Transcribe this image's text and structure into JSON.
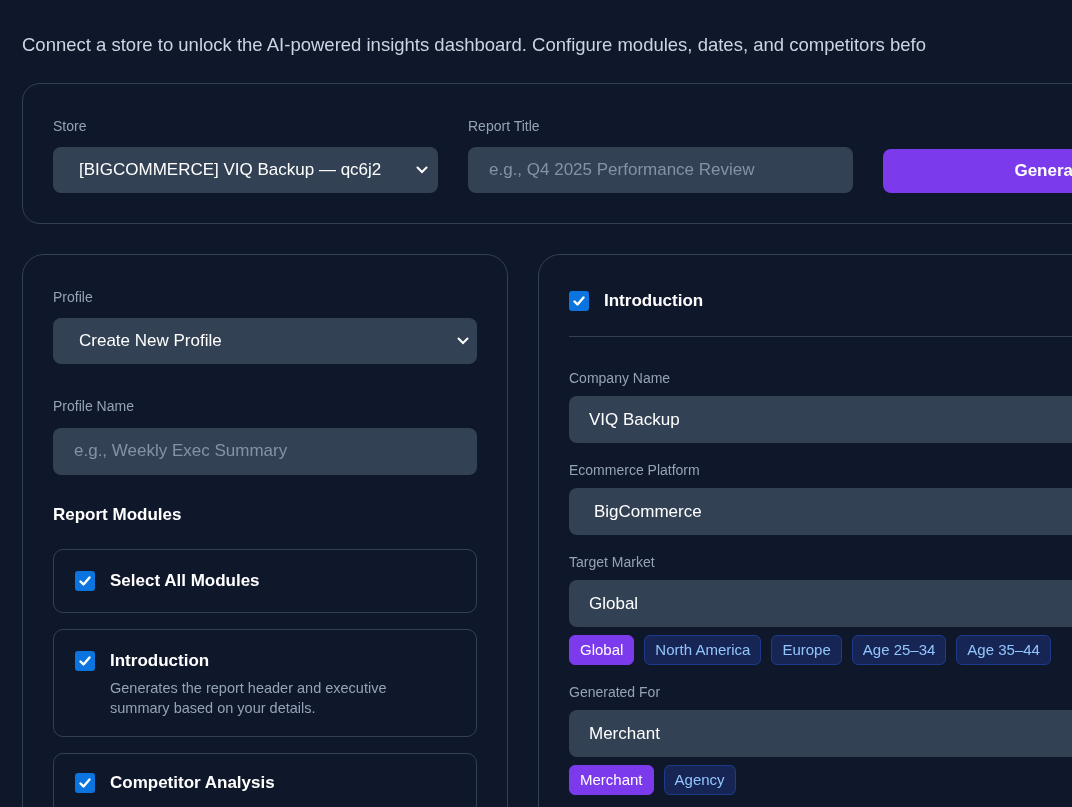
{
  "intro": "Connect a store to unlock the AI-powered insights dashboard. Configure modules, dates, and competitors befo",
  "top_bar": {
    "store": {
      "label": "Store",
      "value": "[BIGCOMMERCE] VIQ Backup — qc6j2"
    },
    "report_title": {
      "label": "Report Title",
      "placeholder": "e.g., Q4 2025 Performance Review"
    },
    "generate_button": "Genera"
  },
  "profile_panel": {
    "profile": {
      "label": "Profile",
      "value": "Create New Profile"
    },
    "profile_name": {
      "label": "Profile Name",
      "placeholder": "e.g., Weekly Exec Summary"
    },
    "modules_heading": "Report Modules",
    "modules": [
      {
        "title": "Select All Modules",
        "checked": true
      },
      {
        "title": "Introduction",
        "description": "Generates the report header and executive summary based on your details.",
        "checked": true
      },
      {
        "title": "Competitor Analysis",
        "checked": true
      }
    ]
  },
  "module_detail": {
    "title": "Introduction",
    "checked": true,
    "fields": [
      {
        "label": "Company Name",
        "value": "VIQ Backup",
        "kind": "input"
      },
      {
        "label": "Ecommerce Platform",
        "value": "BigCommerce",
        "kind": "select"
      },
      {
        "label": "Target Market",
        "value": "Global",
        "kind": "input",
        "chips": [
          {
            "label": "Global",
            "selected": true
          },
          {
            "label": "North America",
            "selected": false
          },
          {
            "label": "Europe",
            "selected": false
          },
          {
            "label": "Age 25–34",
            "selected": false
          },
          {
            "label": "Age 35–44",
            "selected": false
          }
        ]
      },
      {
        "label": "Generated For",
        "value": "Merchant",
        "kind": "input",
        "chips": [
          {
            "label": "Merchant",
            "selected": true
          },
          {
            "label": "Agency",
            "selected": false
          }
        ]
      }
    ]
  }
}
